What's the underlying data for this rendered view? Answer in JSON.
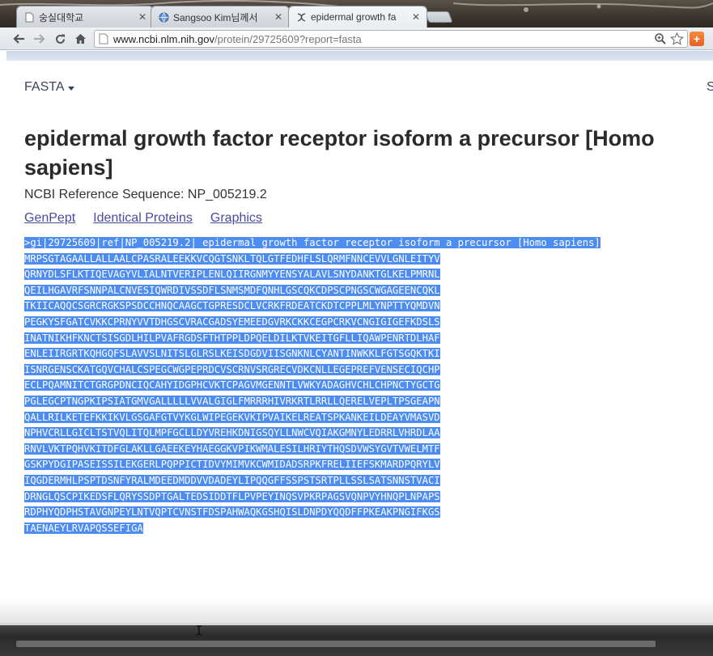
{
  "browser": {
    "tabs": [
      {
        "label": "숭실대학교",
        "favicon": "page-icon"
      },
      {
        "label": "Sangsoo Kim님께서",
        "favicon": "globe-icon"
      },
      {
        "label": "epidermal growth fa",
        "favicon": "ncbi-icon"
      }
    ],
    "url_domain": "www.ncbi.nlm.nih.gov",
    "url_path": "/protein/29725609?report=fasta"
  },
  "page": {
    "format_label": "FASTA",
    "send_to_label": "S",
    "title": "epidermal growth factor receptor isoform a precursor [Homo sapiens]",
    "refseq_label": "NCBI Reference Sequence: NP_005219.2",
    "links": [
      "GenPept",
      "Identical Proteins",
      "Graphics"
    ],
    "fasta_header": ">gi|29725609|ref|NP_005219.2| epidermal growth factor receptor isoform a precursor [Homo sapiens]",
    "sequence_lines": [
      "MRPSGTAGAALLALLAALCPASRALEEKKVCQGTSNKLTQLGTFEDHFLSLQRMFNNCEVVLGNLEITYV",
      "QRNYDLSFLKTIQEVAGYVLIALNTVERIPLENLQIIRGNMYYENSYALAVLSNYDANKTGLKELPMRNL",
      "QEILHGAVRFSNNPALCNVESIQWRDIVSSDFLSNMSMDFQNHLGSCQKCDPSCPNGSCWGAGEENCQKL",
      "TKIICAQQCSGRCRGKSPSDCCHNQCAAGCTGPRESDCLVCRKFRDEATCKDTCPPLMLYNPTTYQMDVN",
      "PEGKYSFGATCVKKCPRNYVVTDHGSCVRACGADSYEMEEDGVRKCKKCEGPCRKVCNGIGIGEFKDSLS",
      "INATNIKHFKNCTSISGDLHILPVAFRGDSFTHTPPLDPQELDILKTVKEITGFLLIQAWPENRTDLHAF",
      "ENLEIIRGRTKQHGQFSLAVVSLNITSLGLRSLKEISDGDVIISGNKNLCYANTINWKKLFGTSGQKTKI",
      "ISNRGENSCKATGQVCHALCSPEGCWGPEPRDCVSCRNVSRGRECVDKCNLLEGEPREFVENSECIQCHP",
      "ECLPQAMNITCTGRGPDNCIQCAHYIDGPHCVKTCPAGVMGENNTLVWKYADAGHVCHLCHPNCTYGCTG",
      "PGLEGCPTNGPKIPSIATGMVGALLLLLVVALGIGLFMRRRHIVRKRTLRRLLQERELVEPLTPSGEAPN",
      "QALLRILKETEFKKIKVLGSGAFGTVYKGLWIPEGEKVKIPVAIKELREATSPKANKEILDEAYVMASVD",
      "NPHVCRLLGICLTSTVQLITQLMPFGCLLDYVREHKDNIGSQYLLNWCVQIAKGMNYLEDRRLVHRDLAA",
      "RNVLVKTPQHVKITDFGLAKLLGAEEKEYHAEGGKVPIKWMALESILHRIYTHQSDVWSYGVTVWELMTF",
      "GSKPYDGIPASEISSILEKGERLPQPPICTIDVYMIMVKCWMIDADSRPKFRELIIEFSKMARDPQRYLV",
      "IQGDERMHLPSPTDSNFYRALMDEEDMDDVVDADEYLIPQQGFFSSPSTSRTPLLSSLSATSNNSTVACI",
      "DRNGLQSCPIKEDSFLQRYSSDPTGALTEDSIDDTFLPVPEYINQSVPKRPAGSVQNPVYHNQPLNPAPS",
      "RDPHYQDPHSTAVGNPEYLNTVQPTCVNSTFDSPAHWAQKGSHQISLDNPDYQQDFFPKEAKPNGIFKGS",
      "TAENAEYLRVAPQSSEFIGA"
    ]
  }
}
